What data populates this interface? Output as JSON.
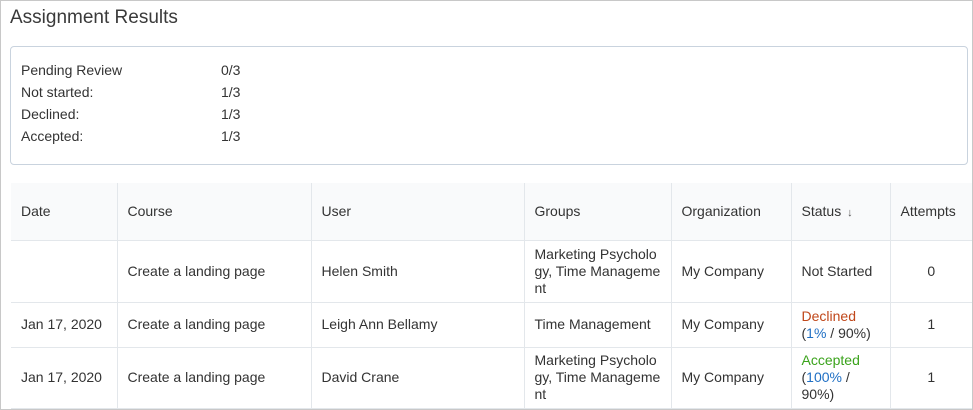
{
  "page": {
    "title": "Assignment Results"
  },
  "summary": [
    {
      "label": "Pending Review",
      "value": "0/3"
    },
    {
      "label": "Not started:",
      "value": "1/3"
    },
    {
      "label": "Declined:",
      "value": "1/3"
    },
    {
      "label": "Accepted:",
      "value": "1/3"
    }
  ],
  "table": {
    "headers": {
      "date": "Date",
      "course": "Course",
      "user": "User",
      "groups": "Groups",
      "organization": "Organization",
      "status": "Status",
      "status_sort_icon": "↓",
      "attempts": "Attempts"
    },
    "rows": [
      {
        "date": "",
        "course": "Create a landing page",
        "user": "Helen Smith",
        "groups": "Marketing Psychology, Time Management",
        "organization": "My Company",
        "status": "Not Started",
        "status_color": "#333333",
        "pct_open": "",
        "pct": "",
        "pct_close": "",
        "attempts": "0"
      },
      {
        "date": "Jan 17, 2020",
        "course": "Create a landing page",
        "user": "Leigh Ann Bellamy",
        "groups": "Time Management",
        "organization": "My Company",
        "status": "Declined",
        "status_color": "#c0471a",
        "pct_open": "(",
        "pct": "1%",
        "pct_close": " / 90%)",
        "attempts": "1"
      },
      {
        "date": "Jan 17, 2020",
        "course": "Create a landing page",
        "user": "David Crane",
        "groups": "Marketing Psychology, Time Management",
        "organization": "My Company",
        "status": "Accepted",
        "status_color": "#3ba31c",
        "pct_open": "(",
        "pct": "100%",
        "pct_close": " / 90%)",
        "attempts": "1"
      }
    ]
  }
}
